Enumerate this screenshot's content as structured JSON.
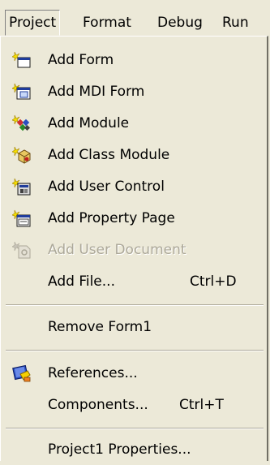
{
  "menubar": {
    "items": [
      "Project",
      "Format",
      "Debug",
      "Run"
    ]
  },
  "menu": {
    "items": [
      {
        "label": "Add Form",
        "icon": "add-form-icon"
      },
      {
        "label": "Add MDI Form",
        "icon": "add-mdi-form-icon"
      },
      {
        "label": "Add Module",
        "icon": "add-module-icon"
      },
      {
        "label": "Add Class Module",
        "icon": "add-class-module-icon"
      },
      {
        "label": "Add User Control",
        "icon": "add-user-control-icon"
      },
      {
        "label": "Add Property Page",
        "icon": "add-property-page-icon"
      },
      {
        "label": "Add User Document",
        "icon": "add-user-document-icon",
        "disabled": true
      },
      {
        "label": "Add File...",
        "shortcut": "Ctrl+D"
      },
      {
        "label": "Remove Form1"
      },
      {
        "label": "References...",
        "icon": "references-icon"
      },
      {
        "label": "Components...",
        "shortcut": "Ctrl+T"
      },
      {
        "label": "Project1 Properties..."
      }
    ]
  },
  "colors": {
    "menu_bg": "#ece9d8",
    "disabled_text": "#aca899",
    "separator": "#aca899"
  }
}
